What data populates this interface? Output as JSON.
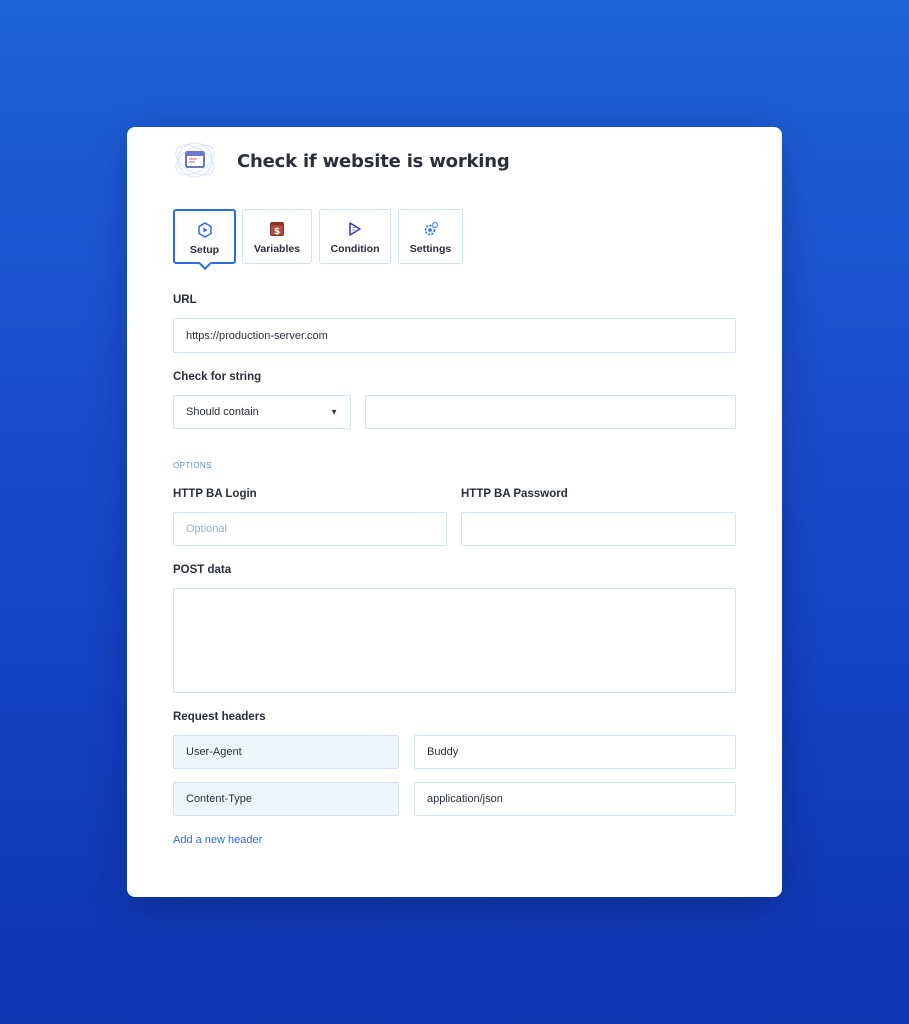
{
  "header": {
    "title": "Check if website is working",
    "icon": "browser-window-icon"
  },
  "tabs": [
    {
      "label": "Setup",
      "icon": "play-circle-icon",
      "active": true
    },
    {
      "label": "Variables",
      "icon": "dollar-box-icon",
      "active": false
    },
    {
      "label": "Condition",
      "icon": "condition-play-icon",
      "active": false
    },
    {
      "label": "Settings",
      "icon": "gear-icon",
      "active": false
    }
  ],
  "url": {
    "label": "URL",
    "value": "https://production-server.com"
  },
  "check_string": {
    "label": "Check for string",
    "mode": "Should contain",
    "value": ""
  },
  "options": {
    "section_label": "OPTIONS",
    "login_label": "HTTP BA Login",
    "login_placeholder": "Optional",
    "password_label": "HTTP BA Password",
    "password_value": ""
  },
  "post_data": {
    "label": "POST data",
    "value": ""
  },
  "request_headers": {
    "label": "Request headers",
    "rows": [
      {
        "name": "User-Agent",
        "value": "Buddy"
      },
      {
        "name": "Content-Type",
        "value": "application/json"
      }
    ],
    "add_link": "Add a new header"
  },
  "colors": {
    "accent": "#2a6de0",
    "background_top": "#1e63d8",
    "background_bottom": "#0f35b3"
  }
}
